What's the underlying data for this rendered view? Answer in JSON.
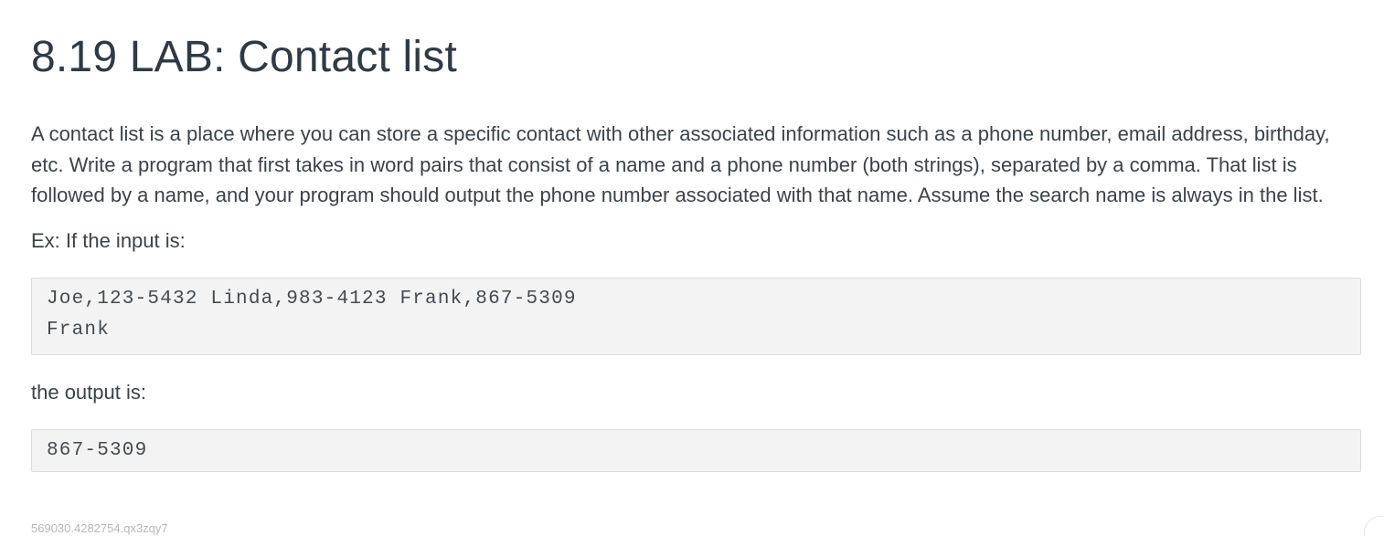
{
  "page": {
    "title": "8.19 LAB: Contact list",
    "description": "A contact list is a place where you can store a specific contact with other associated information such as a phone number, email address, birthday, etc. Write a program that first takes in word pairs that consist of a name and a phone number (both strings), separated by a comma. That list is followed by a name, and your program should output the phone number associated with that name. Assume the search name is always in the list.",
    "example_label": "Ex: If the input is:",
    "input_lines": [
      "Joe,123-5432 Linda,983-4123 Frank,867-5309",
      "Frank"
    ],
    "output_label": "the output is:",
    "output_lines": [
      "867-5309"
    ],
    "footer_id": "569030.4282754.qx3zqy7"
  }
}
